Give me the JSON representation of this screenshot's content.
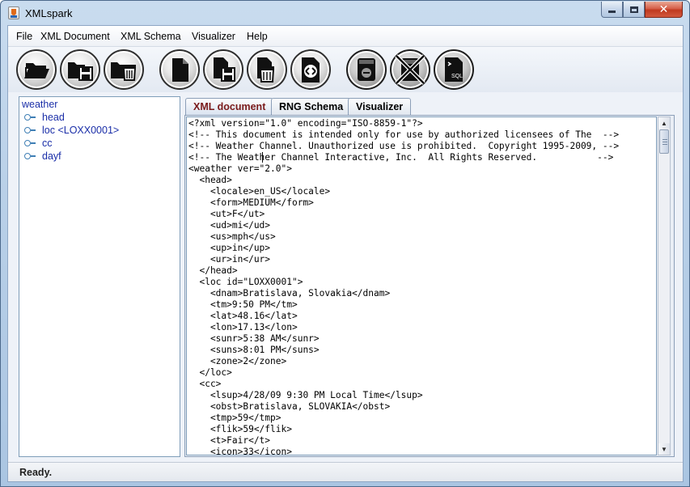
{
  "window": {
    "title": "XMLspark"
  },
  "menu": [
    "File",
    "XML Document",
    "XML Schema",
    "Visualizer",
    "Help"
  ],
  "toolbar": [
    {
      "icon": "open-folder-icon"
    },
    {
      "icon": "save-folder-icon"
    },
    {
      "icon": "delete-folder-icon"
    },
    {
      "icon": "new-document-icon"
    },
    {
      "icon": "save-document-icon"
    },
    {
      "icon": "delete-document-icon"
    },
    {
      "icon": "validate-document-icon"
    },
    {
      "icon": "database-icon"
    },
    {
      "icon": "disconnect-database-icon"
    },
    {
      "icon": "sql-icon",
      "label": "SQL"
    }
  ],
  "tree": {
    "root": "weather",
    "children": [
      "head",
      "loc <LOXX0001>",
      "cc",
      "dayf"
    ]
  },
  "tabs": [
    "XML document",
    "RNG Schema",
    "Visualizer"
  ],
  "active_tab": "XML document",
  "editor": {
    "lines": [
      "<?xml version=\"1.0\" encoding=\"ISO-8859-1\"?>",
      "<!-- This document is intended only for use by authorized licensees of The  -->",
      "<!-- Weather Channel. Unauthorized use is prohibited.  Copyright 1995-2009, -->",
      "<!-- The Weather Channel Interactive, Inc.  All Rights Reserved.           -->",
      "<weather ver=\"2.0\">",
      "  <head>",
      "    <locale>en_US</locale>",
      "    <form>MEDIUM</form>",
      "    <ut>F</ut>",
      "    <ud>mi</ud>",
      "    <us>mph</us>",
      "    <up>in</up>",
      "    <ur>in</ur>",
      "  </head>",
      "  <loc id=\"LOXX0001\">",
      "    <dnam>Bratislava, Slovakia</dnam>",
      "    <tm>9:50 PM</tm>",
      "    <lat>48.16</lat>",
      "    <lon>17.13</lon>",
      "    <sunr>5:38 AM</sunr>",
      "    <suns>8:01 PM</suns>",
      "    <zone>2</zone>",
      "  </loc>",
      "  <cc>",
      "    <lsup>4/28/09 9:30 PM Local Time</lsup>",
      "    <obst>Bratislava, SLOVAKIA</obst>",
      "    <tmp>59</tmp>",
      "    <flik>59</flik>",
      "    <t>Fair</t>",
      "    <icon>33</icon>"
    ]
  },
  "status": "Ready."
}
